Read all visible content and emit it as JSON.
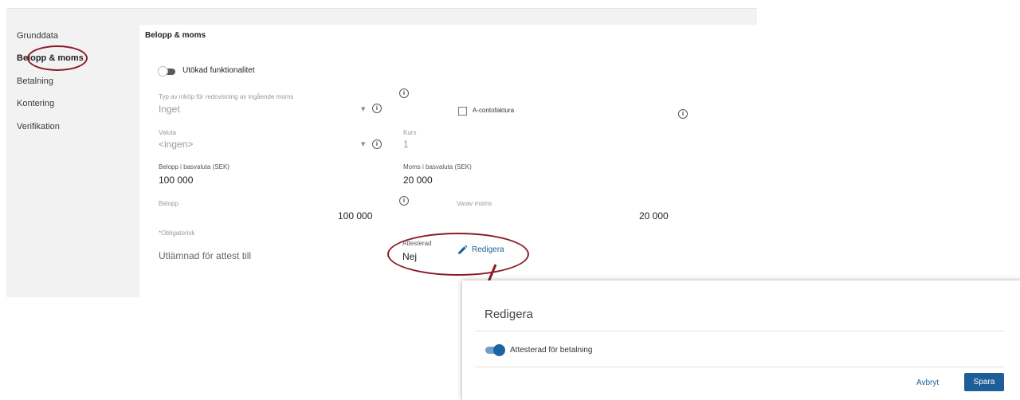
{
  "sidebar": {
    "items": [
      {
        "label": "Grunddata"
      },
      {
        "label": "Belopp & moms"
      },
      {
        "label": "Betalning"
      },
      {
        "label": "Kontering"
      },
      {
        "label": "Verifikation"
      }
    ]
  },
  "section": {
    "title": "Belopp & moms"
  },
  "toggle_extended": {
    "label": "Utökad funktionalitet",
    "on": false
  },
  "purchase_type": {
    "label": "Typ av inköp för redovisning av ingående moms",
    "value": "Inget"
  },
  "a_conto": {
    "label": "A-contofaktura",
    "checked": false
  },
  "currency": {
    "label": "Valuta",
    "value": "<ingen>"
  },
  "rate": {
    "label": "Kurs",
    "value": "1"
  },
  "base_amount": {
    "label": "Belopp i basvaluta (SEK)",
    "value": "100 000"
  },
  "base_vat": {
    "label": "Moms i basvaluta (SEK)",
    "value": "20 000"
  },
  "amount": {
    "label": "Belopp",
    "value": "100 000"
  },
  "vat_of_which": {
    "label": "Varav moms",
    "value": "20 000"
  },
  "required_note": "*Obligatorisk",
  "attest": {
    "sent_label": "Utlämnad för attest till",
    "attested_label": "Attesterad",
    "attested_value": "Nej",
    "edit_label": "Redigera"
  },
  "dialog": {
    "title": "Redigera",
    "toggle_label": "Attesterad för betalning",
    "toggle_on": true,
    "cancel_label": "Avbryt",
    "save_label": "Spara"
  },
  "colors": {
    "accent": "#1d5e98",
    "annotation": "#8a1d2a"
  },
  "icons": {
    "info": "info-icon",
    "edit": "pencil-icon",
    "dropdown": "chevron-down-icon"
  }
}
